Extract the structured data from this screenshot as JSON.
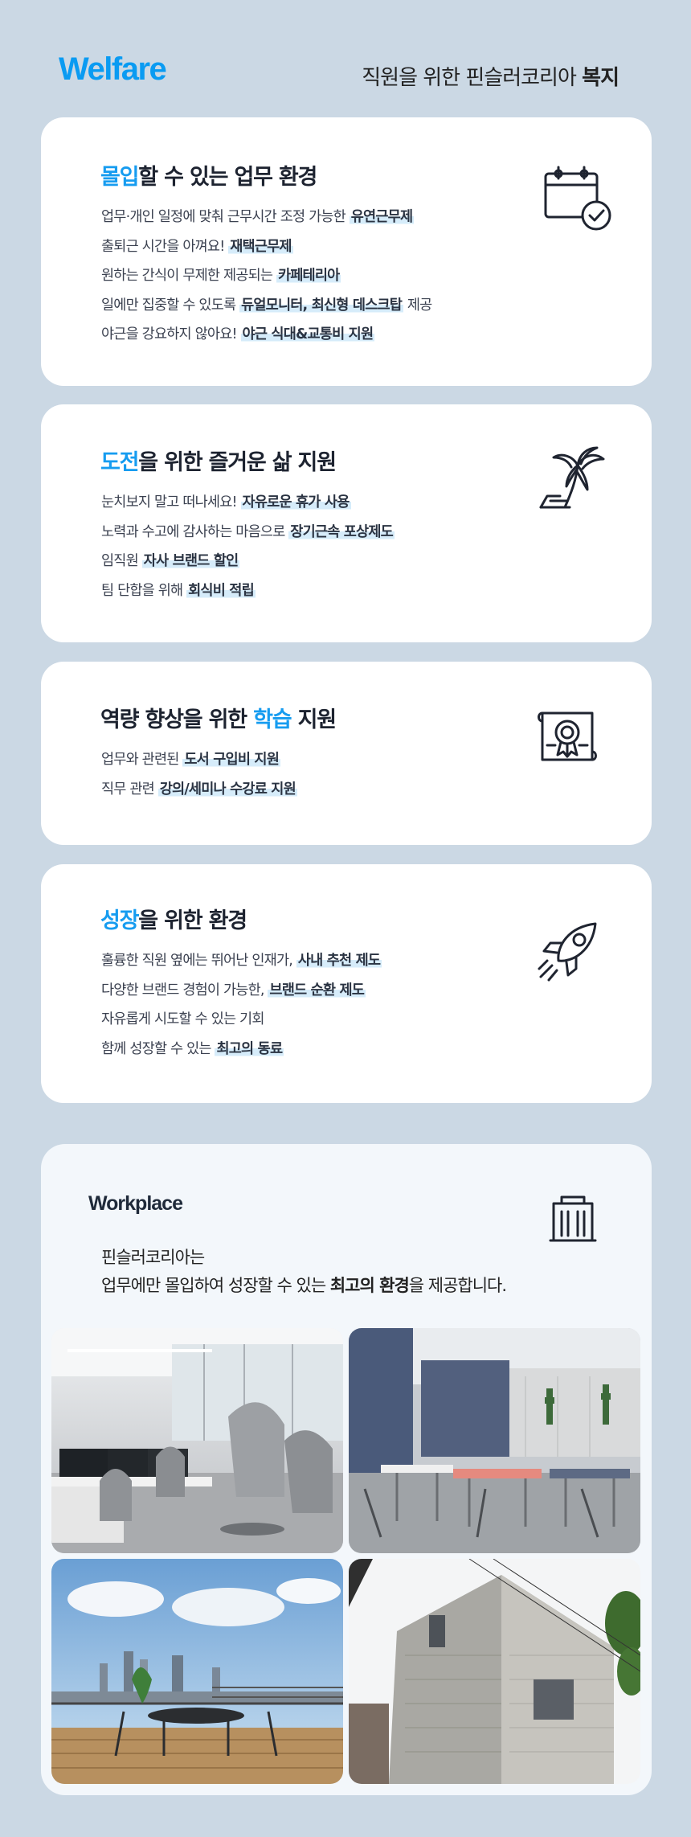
{
  "header": {
    "logo": "Welfare",
    "tagline_prefix": "직원을 위한 핀슬러코리아 ",
    "tagline_emphasis": "복지"
  },
  "cards": [
    {
      "title_accent": "몰입",
      "title_rest": "할 수 있는 업무 환경",
      "icon": "calendar-check-icon",
      "lines": [
        {
          "pre": "업무·개인 일정에 맞춰 근무시간 조정 가능한 ",
          "hl": "유연근무제",
          "post": ""
        },
        {
          "pre": "출퇴근 시간을 아껴요! ",
          "hl": "재택근무제",
          "post": ""
        },
        {
          "pre": "원하는 간식이 무제한 제공되는 ",
          "hl": "카페테리아",
          "post": ""
        },
        {
          "pre": "일에만 집중할 수 있도록 ",
          "hl": "듀얼모니터, 최신형 데스크탑",
          "post": " 제공"
        },
        {
          "pre": "야근을 강요하지 않아요! ",
          "hl": "야근 식대&교통비 지원",
          "post": ""
        }
      ]
    },
    {
      "title_accent": "도전",
      "title_rest": "을 위한 즐거운 삶 지원",
      "icon": "palm-tree-icon",
      "lines": [
        {
          "pre": "눈치보지 말고 떠나세요! ",
          "hl": "자유로운 휴가 사용",
          "post": ""
        },
        {
          "pre": "노력과 수고에 감사하는 마음으로 ",
          "hl": "장기근속 포상제도",
          "post": ""
        },
        {
          "pre": "임직원 ",
          "hl": "자사 브랜드 할인",
          "post": ""
        },
        {
          "pre": "팀 단합을 위해 ",
          "hl": "회식비 적립",
          "post": ""
        }
      ]
    },
    {
      "title_pre": "역량 향상을 위한 ",
      "title_accent": "학습",
      "title_rest": " 지원",
      "icon": "certificate-icon",
      "lines": [
        {
          "pre": "업무와 관련된 ",
          "hl": "도서 구입비 지원",
          "post": ""
        },
        {
          "pre": "직무 관련 ",
          "hl": "강의/세미나 수강료 지원",
          "post": ""
        }
      ]
    },
    {
      "title_accent": "성장",
      "title_rest": "을 위한 환경",
      "icon": "rocket-icon",
      "lines": [
        {
          "pre": "훌륭한 직원 옆에는 뛰어난 인재가, ",
          "hl": "사내 추천 제도",
          "post": ""
        },
        {
          "pre": "다양한 브랜드 경험이 가능한, ",
          "hl": "브랜드 순환 제도",
          "post": ""
        },
        {
          "pre": "자유롭게 시도할 수 있는 기회",
          "hl": "",
          "post": ""
        },
        {
          "pre": "함께 성장할 수 있는 ",
          "hl": "최고의 동료",
          "post": ""
        }
      ]
    }
  ],
  "workplace": {
    "title": "Workplace",
    "icon": "office-building-icon",
    "desc_line1": "핀슬러코리아는",
    "desc_line2_pre": "업무에만 몰입하여 성장할 수 있는 ",
    "desc_line2_emphasis": "최고의 환경",
    "desc_line2_post": "을 제공합니다.",
    "photos": [
      "office-desks-photo",
      "cafeteria-terrace-photo",
      "rooftop-terrace-photo",
      "building-exterior-photo"
    ]
  },
  "colors": {
    "background": "#cbd8e4",
    "accent": "#169cf0",
    "logo": "#0a9bf2",
    "highlight": "#d6ecfa",
    "card": "#ffffff"
  }
}
